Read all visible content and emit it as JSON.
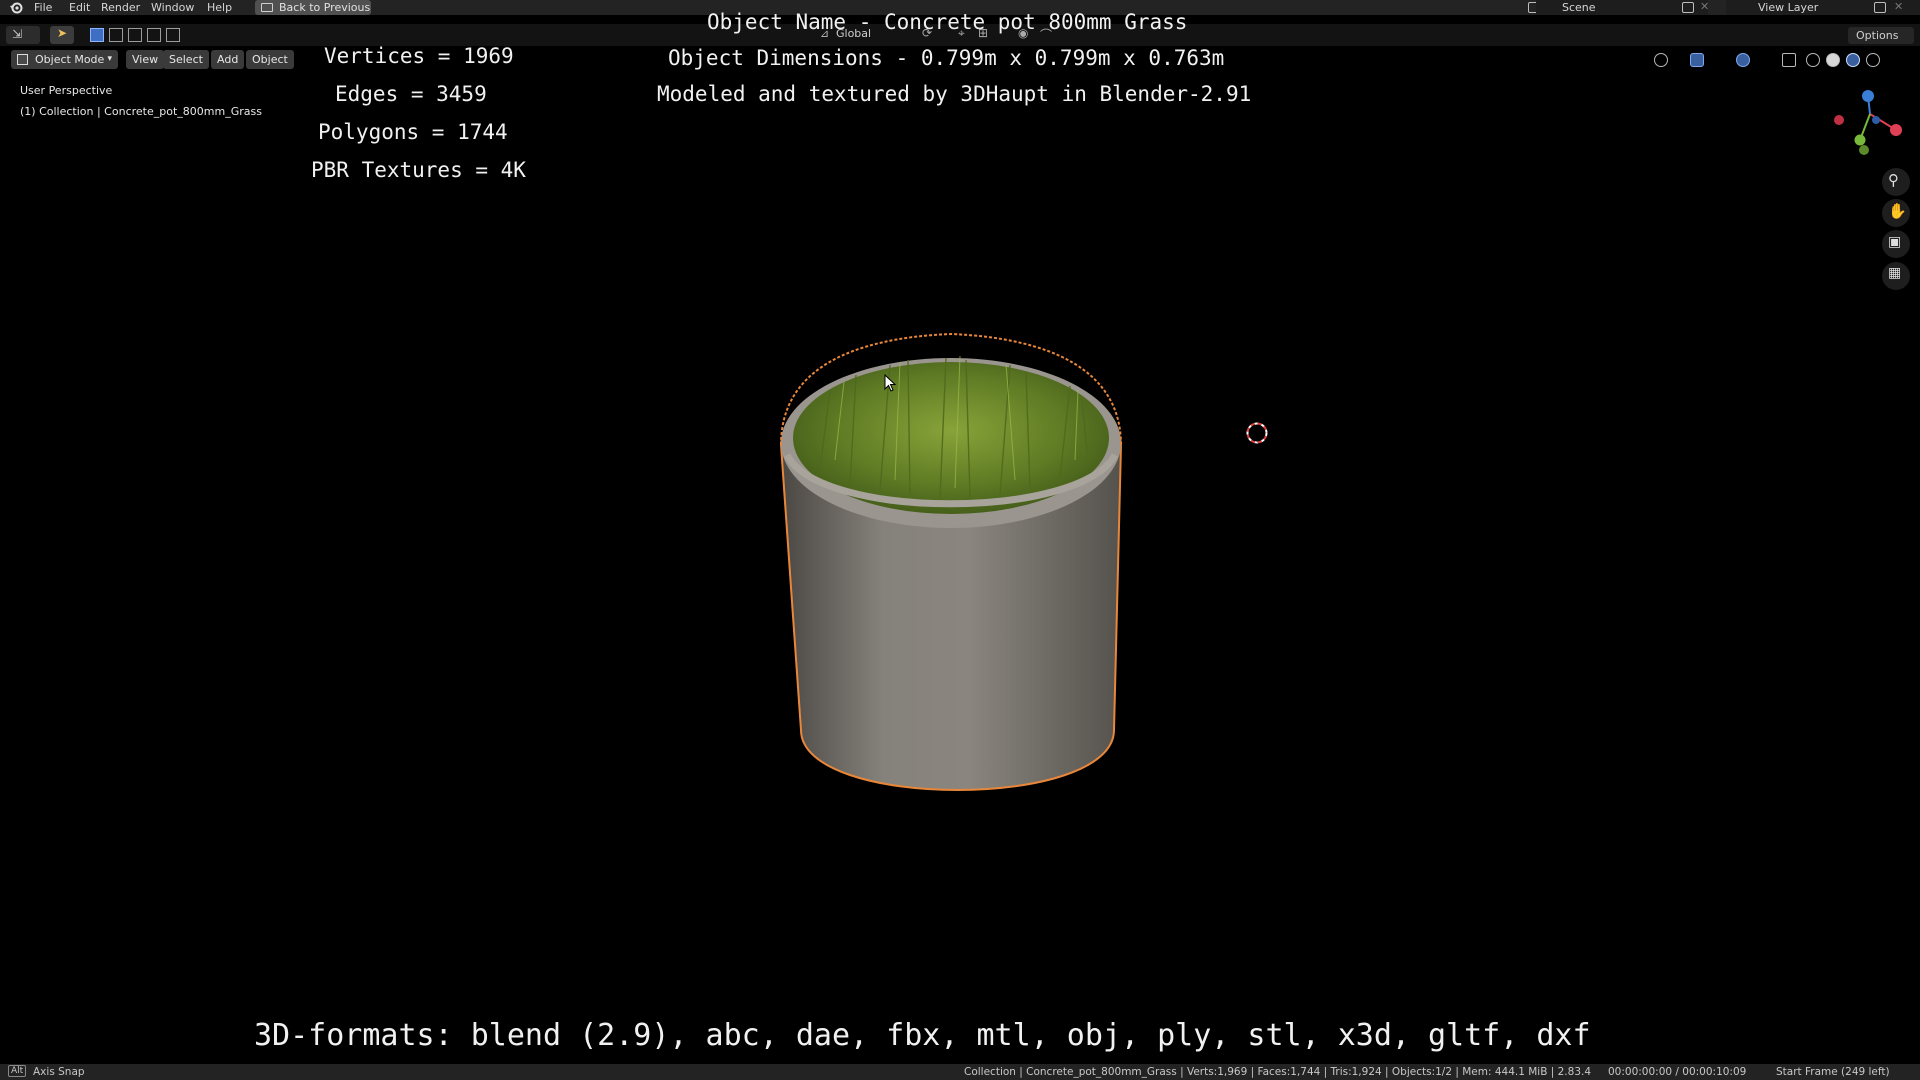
{
  "menu": {
    "items": [
      "File",
      "Edit",
      "Render",
      "Window",
      "Help"
    ],
    "back_label": "Back to Previous",
    "scene": "Scene",
    "view_layer": "View Layer"
  },
  "toolbar": {
    "orientation": "Global",
    "options": "Options"
  },
  "viewport_header": {
    "mode": "Object Mode",
    "view": "View",
    "select": "Select",
    "add": "Add",
    "object": "Object"
  },
  "viewport_info": {
    "perspective": "User Perspective",
    "collection": "(1) Collection | Concrete_pot_800mm_Grass"
  },
  "overlay": {
    "vertices": "Vertices = 1969",
    "edges": "Edges = 3459",
    "polygons": "Polygons = 1744",
    "textures": "PBR Textures = 4K",
    "object_name": "Object Name - Concrete pot 800mm Grass",
    "dimensions": "Object Dimensions -  0.799m x 0.799m x 0.763m",
    "credit": "Modeled and textured by 3DHaupt in Blender-2.91",
    "formats": "3D-formats: blend (2.9), abc, dae, fbx, mtl, obj, ply, stl, x3d, gltf, dxf"
  },
  "status": {
    "alt_key": "Alt",
    "axis_snap": "Axis Snap",
    "scene_stats": "Collection | Concrete_pot_800mm_Grass | Verts:1,969 | Faces:1,744 | Tris:1,924 | Objects:1/2 | Mem: 444.1 MiB | 2.83.4",
    "time": "00:00:00:00 / 00:00:10:09",
    "start_frame": "Start Frame (249 left)"
  },
  "colors": {
    "selection_outline": "#e8873a",
    "grass": "#6f8a2c",
    "concrete": "#7a7670",
    "axis_x": "#e04055",
    "axis_y": "#78b83a",
    "axis_z": "#3a7ed8"
  }
}
